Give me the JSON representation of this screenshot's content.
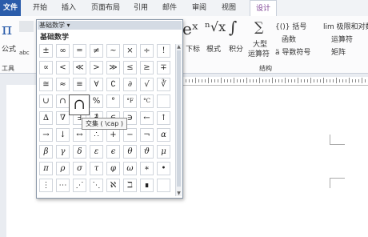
{
  "tabs": {
    "file": "文件",
    "home": "开始",
    "insert": "插入",
    "layout": "页面布局",
    "references": "引用",
    "mailings": "邮件",
    "review": "审阅",
    "view": "视图",
    "design": "设计"
  },
  "ribbon": {
    "formula_sym": "π",
    "formula_label": "公式",
    "abc": "abc",
    "tools_label": "工具",
    "ex_sym": "eˣ",
    "subscript_label": "下标",
    "radical_sym": "ⁿ√x",
    "radical_label": "根式",
    "integral_sym": "∫",
    "integral_label": "积分",
    "sum_sym": "∑",
    "large_op_label1": "大型",
    "large_op_label2": "运算符",
    "bracket_label": "{()} 括号",
    "function_label": "函数",
    "accent_label": "ä 导数符号",
    "limit_label": "lim 极限和对数",
    "operator_label": "运算符",
    "matrix_label": "矩阵",
    "structure_label": "结构"
  },
  "panel": {
    "header": "基础数学 ▾",
    "subtitle": "基础数学"
  },
  "symbols": [
    "±",
    "∞",
    "=",
    "≠",
    "~",
    "×",
    "÷",
    "!",
    "∝",
    "<",
    "≪",
    ">",
    "≫",
    "≤",
    "≥",
    "∓",
    "≅",
    "≈",
    "≡",
    "∀",
    "∁",
    "∂",
    "√",
    "∛",
    "∪",
    "∩",
    "∅",
    "%",
    "°",
    "°F",
    "°C",
    "",
    "∆",
    "∇",
    "∃",
    "∄",
    "∈",
    "∋",
    "←",
    "↑",
    "→",
    "↓",
    "↔",
    "∴",
    "+",
    "−",
    "¬",
    "α",
    "β",
    "γ",
    "δ",
    "ε",
    "ϵ",
    "θ",
    "ϑ",
    "μ",
    "π",
    "ρ",
    "σ",
    "τ",
    "φ",
    "ω",
    "∗",
    "•",
    "⋮",
    "⋯",
    "⋰",
    "⋱",
    "ℵ",
    "ℶ",
    "∎",
    ""
  ],
  "hover_symbol": "∩",
  "tooltip": "交集 ( \\cap )"
}
